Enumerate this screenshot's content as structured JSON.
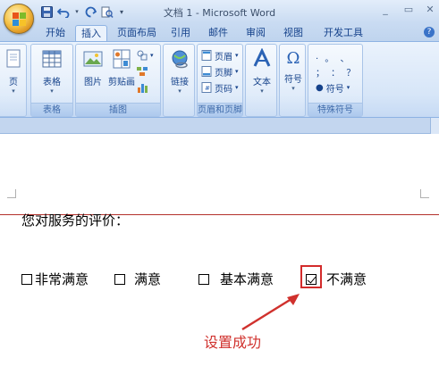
{
  "window": {
    "title": "文档 1 - Microsoft Word",
    "controls": [
      "_",
      "▭",
      "✕"
    ]
  },
  "tabs": [
    {
      "label": "开始",
      "active": false
    },
    {
      "label": "插入",
      "active": true
    },
    {
      "label": "页面布局",
      "active": false
    },
    {
      "label": "引用",
      "active": false
    },
    {
      "label": "邮件",
      "active": false
    },
    {
      "label": "审阅",
      "active": false
    },
    {
      "label": "视图",
      "active": false
    },
    {
      "label": "开发工具",
      "active": false
    }
  ],
  "ribbon": {
    "page_group": {
      "button": "页"
    },
    "table_group": {
      "label": "表格",
      "button": "表格"
    },
    "illustrations_group": {
      "label": "插图",
      "picture": "图片",
      "clipart": "剪贴画"
    },
    "links_group": {
      "button": "链接"
    },
    "header_footer_group": {
      "label": "页眉和页脚",
      "header": "页眉",
      "footer": "页脚",
      "page_number": "页码"
    },
    "text_group": {
      "button": "文本"
    },
    "symbols_group": {
      "button": "符号"
    },
    "special_chars_group": {
      "label": "特殊符号",
      "symbol_dropdown": "符号",
      "chars_row1": "·  。 、",
      "chars_row2": "；  ：  ？"
    }
  },
  "document": {
    "prompt": "您对服务的评价：",
    "options": [
      {
        "label": "非常满意",
        "checked": false
      },
      {
        "label": "满意",
        "checked": false
      },
      {
        "label": "基本满意",
        "checked": false
      },
      {
        "label": "不满意",
        "checked": true
      }
    ],
    "annotation": "设置成功"
  },
  "colors": {
    "ribbon_text": "#15428b",
    "annotation": "#d0312d",
    "highlight_border": "#d32b2b"
  }
}
